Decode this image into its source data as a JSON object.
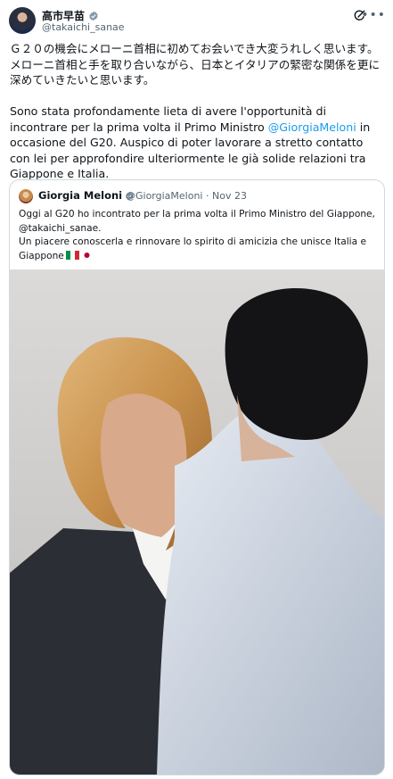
{
  "post": {
    "author_name": "高市早苗",
    "author_handle": "@takaichi_sanae",
    "text_ja": "Ｇ２０の機会にメローニ首相に初めてお会いでき大変うれしく思います。メローニ首相と手を取り合いながら、日本とイタリアの緊密な関係を更に深めていきたいと思います。",
    "text_it_before": "Sono stata profondamente lieta di avere l'opportunità di incontrare per la prima volta il Primo Ministro ",
    "mention": "@GiorgiaMeloni",
    "text_it_after": " in occasione del G20. Auspico di poter lavorare a stretto contatto con lei per approfondire ulteriormente le già solide relazioni tra Giappone e Italia."
  },
  "quote": {
    "author_name": "Giorgia Meloni",
    "meta": "@GiorgiaMeloni · Nov 23",
    "text": "Oggi al G20 ho incontrato per la prima volta il Primo Ministro del Giappone, @takaichi_sanae.\nUn piacere conoscerla e rinnovare lo spirito di amicizia che unisce Italia e Giappone"
  },
  "icons": [
    "verified-badge-icon",
    "grok-icon",
    "more-icon",
    "italy-flag-icon",
    "japan-flag-icon"
  ],
  "colors": {
    "link": "#1d9bf0",
    "secondary_text": "#536471",
    "border": "#cfd9de",
    "verified": "#829aab"
  }
}
